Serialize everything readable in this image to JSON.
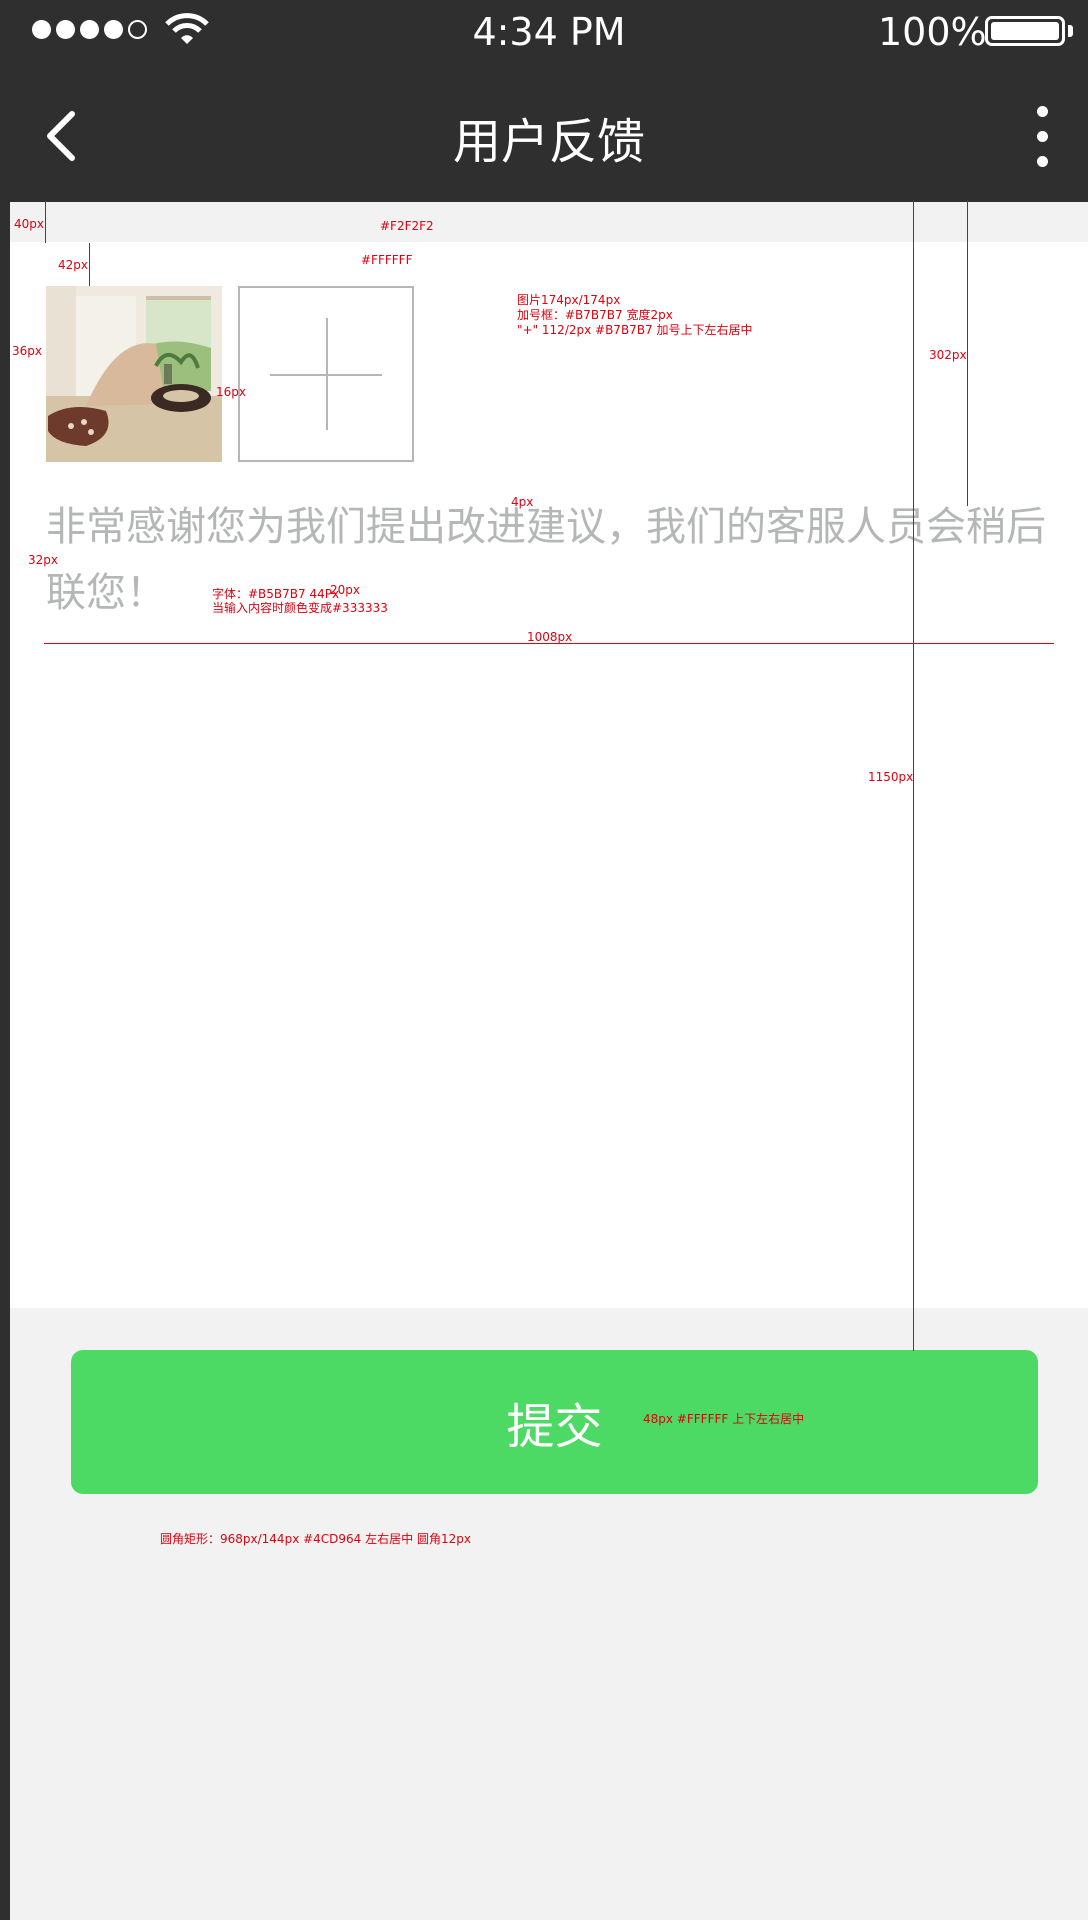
{
  "status_bar": {
    "time": "4:34 PM",
    "battery": "100%"
  },
  "nav": {
    "title": "用户反馈"
  },
  "feedback": {
    "placeholder": "非常感谢您为我们提出改进建议，我们的客服人员会稍后联您！"
  },
  "submit": {
    "label": "提交"
  },
  "colors": {
    "nav_bg": "#2F2F2F",
    "page_bg": "#F2F2F2",
    "content_bg": "#FFFFFF",
    "accent": "#4CD964",
    "border": "#B7B7B7",
    "placeholder": "#B5B7B7"
  },
  "annotations": {
    "m40": "40px",
    "bg1": "#F2F2F2",
    "m42": "42px",
    "bg2": "#FFFFFF",
    "img1": "图片174px/174px",
    "img2": "加号框：#B7B7B7    宽度2px",
    "img3": "\"+\"  112/2px   #B7B7B7    加号上下左右居中",
    "m302": "302px",
    "m36": "36px",
    "m16": "16px",
    "m4": "4px",
    "m32": "32px",
    "font1": "字体：#B5B7B7   44Px",
    "m20": "20px",
    "font2": "当输入内容时颜色变成#333333",
    "m1008": "1008px",
    "m1150": "1150px",
    "btn_text": "48px   #FFFFFF   上下左右居中",
    "btn_rect": "圆角矩形：968px/144px     #4CD964    左右居中   圆角12px"
  }
}
